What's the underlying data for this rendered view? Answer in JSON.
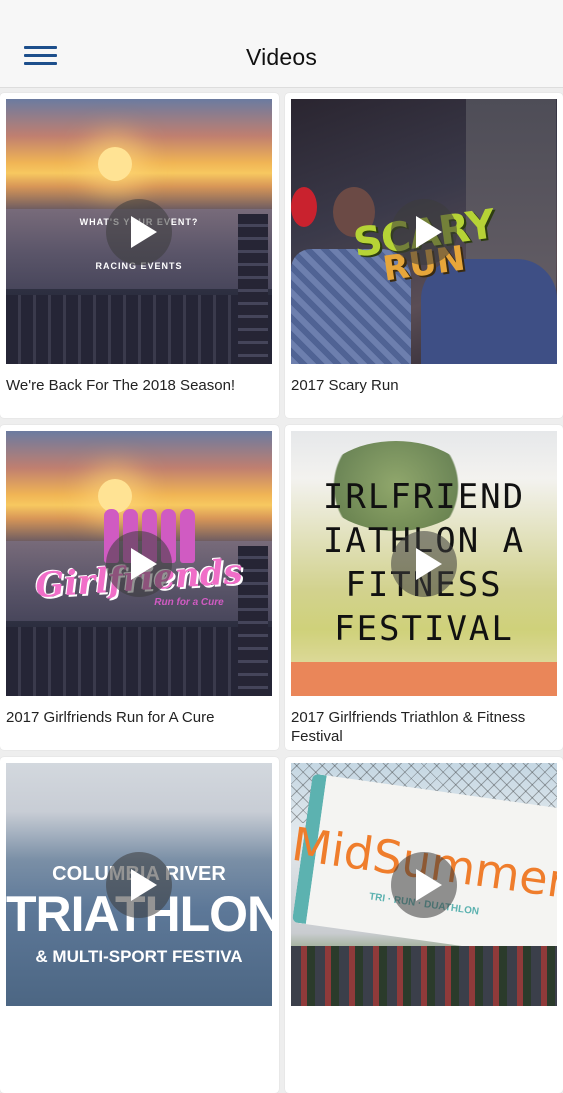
{
  "header": {
    "title": "Videos",
    "menu_icon": "hamburger-menu-icon",
    "accent_color": "#1d4f8c"
  },
  "videos": [
    {
      "caption": "We're Back For The 2018 Season!",
      "logo_line1": "WHAT'S YOUR EVENT?",
      "logo_line2": "RACING EVENTS"
    },
    {
      "caption": "2017 Scary Run",
      "logo_line1": "SCARY",
      "logo_line2": "RUN"
    },
    {
      "caption": "2017 Girlfriends Run for A Cure",
      "logo_line1": "Girlfriends",
      "logo_line2": "Run for a Cure"
    },
    {
      "caption": "2017 Girlfriends Triathlon & Fitness Festival",
      "logo_line1": "IRLFRIEND",
      "logo_line2": "IATHLON A",
      "logo_line3": "FITNESS",
      "logo_line4": "FESTIVAL"
    },
    {
      "caption": "",
      "logo_line1": "COLUMBIA RIVER",
      "logo_line2": "TRIATHLON",
      "logo_line3": "& MULTI-SPORT FESTIVA"
    },
    {
      "caption": "",
      "logo_line1": "MidSummer",
      "logo_line2": "TRI · RUN · DUATHLON"
    }
  ]
}
